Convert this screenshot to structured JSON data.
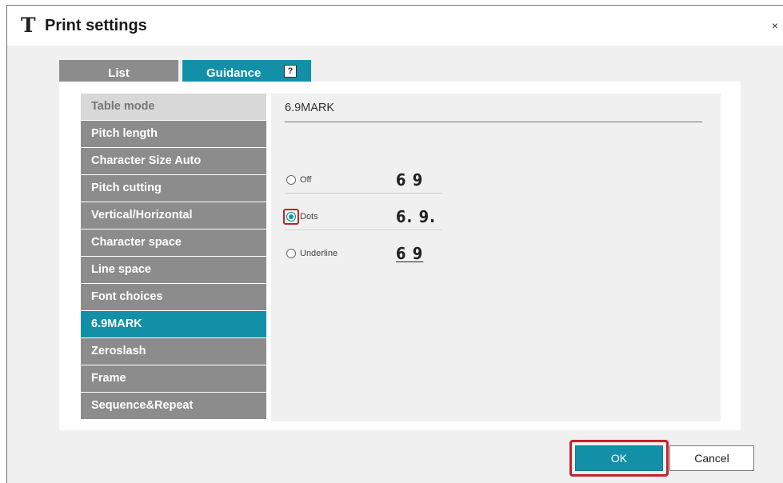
{
  "window": {
    "title": "Print settings",
    "title_icon": "T",
    "close_label": "×"
  },
  "tabs": [
    {
      "label": "List",
      "active": false
    },
    {
      "label": "Guidance",
      "active": true
    }
  ],
  "help_icon_label": "?",
  "menu": [
    {
      "label": "Table mode",
      "state": "disabled"
    },
    {
      "label": "Pitch length",
      "state": "normal"
    },
    {
      "label": "Character Size Auto",
      "state": "normal"
    },
    {
      "label": "Pitch cutting",
      "state": "normal"
    },
    {
      "label": "Vertical/Horizontal",
      "state": "normal"
    },
    {
      "label": "Character space",
      "state": "normal"
    },
    {
      "label": "Line space",
      "state": "normal"
    },
    {
      "label": "Font choices",
      "state": "normal"
    },
    {
      "label": "6.9MARK",
      "state": "active"
    },
    {
      "label": "Zeroslash",
      "state": "normal"
    },
    {
      "label": "Frame",
      "state": "normal"
    },
    {
      "label": "Sequence&Repeat",
      "state": "normal"
    }
  ],
  "detail": {
    "title": "6.9MARK",
    "options": [
      {
        "label": "Off",
        "sample": "6 9",
        "checked": false
      },
      {
        "label": "Dots",
        "sample": "6. 9.",
        "checked": true
      },
      {
        "label": "Underline",
        "sample": "6 9",
        "checked": false
      }
    ]
  },
  "buttons": {
    "ok": "OK",
    "cancel": "Cancel"
  },
  "colors": {
    "accent": "#1290a7",
    "inactive_tab": "#8c8c8c",
    "highlight": "#c8202a"
  }
}
